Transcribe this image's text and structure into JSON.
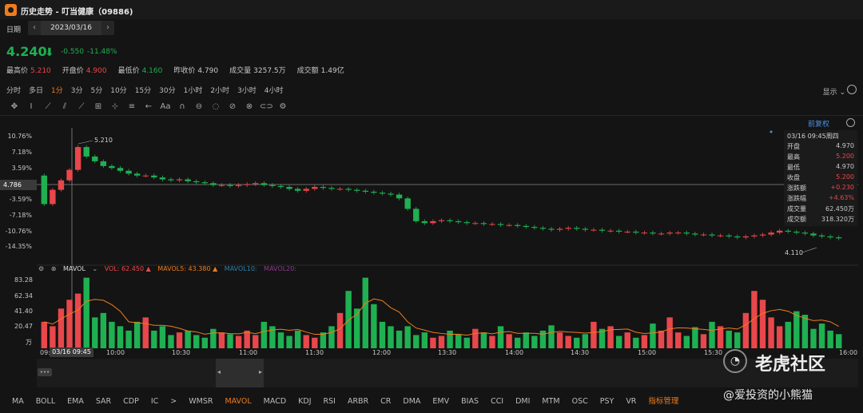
{
  "window": {
    "title": "历史走势 - 叮当健康（09886)"
  },
  "date_picker": {
    "label": "日期",
    "value": "2023/03/16",
    "prev_icon": "chevron-left-icon",
    "next_icon": "chevron-right-icon"
  },
  "quote": {
    "price": "4.240",
    "change": "-0.550",
    "change_pct": "-11.48%",
    "stats": [
      {
        "label": "最高价",
        "value": "5.210",
        "color": "red"
      },
      {
        "label": "开盘价",
        "value": "4.900",
        "color": "red"
      },
      {
        "label": "最低价",
        "value": "4.160",
        "color": "green"
      },
      {
        "label": "昨收价",
        "value": "4.790",
        "color": "grey"
      },
      {
        "label": "成交量",
        "value": "3257.5万",
        "color": "grey"
      },
      {
        "label": "成交额",
        "value": "1.49亿",
        "color": "grey"
      }
    ]
  },
  "periods": [
    "分时",
    "多日",
    "1分",
    "3分",
    "5分",
    "10分",
    "15分",
    "30分",
    "1小时",
    "2小时",
    "3小时",
    "4小时"
  ],
  "active_period": "1分",
  "display_menu": "显示",
  "restore_label": "前复权",
  "toolbar_icons": [
    "move-icon",
    "pointer-icon",
    "trend-line-icon",
    "parallel-icon",
    "channel-icon",
    "measure-icon",
    "ruler-icon",
    "fib-icon",
    "arrow-icon",
    "text-icon",
    "magnet-icon",
    "lock-icon",
    "eraser-icon",
    "hide-icon",
    "delete-icon",
    "link-icon",
    "settings-icon"
  ],
  "price_axis": [
    "10.76%",
    "7.18%",
    "3.59%",
    "4.786",
    "-3.59%",
    "-7.18%",
    "-10.76%",
    "-14.35%"
  ],
  "price_markers": {
    "high": "5.210",
    "low": "4.110",
    "prev_close_tag": "4.786"
  },
  "info_panel": {
    "header": "03/16 09:45周四",
    "rows": [
      {
        "label": "开盘",
        "value": "4.970",
        "color": "grey"
      },
      {
        "label": "最高",
        "value": "5.200",
        "color": "red"
      },
      {
        "label": "最低",
        "value": "4.970",
        "color": "grey"
      },
      {
        "label": "收盘",
        "value": "5.200",
        "color": "red"
      },
      {
        "label": "涨跌额",
        "value": "+0.230",
        "color": "red"
      },
      {
        "label": "涨跌幅",
        "value": "+4.63%",
        "color": "red"
      },
      {
        "label": "成交量",
        "value": "62.450万",
        "color": "grey"
      },
      {
        "label": "成交额",
        "value": "318.320万",
        "color": "grey"
      }
    ]
  },
  "volume": {
    "indicator": "MAVOL",
    "vol": "VOL: 62.450 ▲",
    "mavol5": "MAVOL5: 43.380 ▲",
    "mavol10": "MAVOL10:",
    "mavol20": "MAVOL20:",
    "axis": [
      "83.28",
      "62.34",
      "41.40",
      "20.47",
      "万"
    ]
  },
  "time_axis": [
    "09:",
    "10:00",
    "10:30",
    "11:00",
    "11:30",
    "12:00",
    "13:30",
    "14:00",
    "14:30",
    "15:00",
    "15:30",
    "16:00"
  ],
  "time_cursor": "03/16 09:45",
  "indicators": [
    "MA",
    "BOLL",
    "EMA",
    "SAR",
    "CDP",
    "IC",
    ">",
    "WMSR",
    "MAVOL",
    "MACD",
    "KDJ",
    "RSI",
    "ARBR",
    "CR",
    "DMA",
    "EMV",
    "BIAS",
    "CCI",
    "DMI",
    "MTM",
    "OSC",
    "PSY",
    "VR",
    "指标管理"
  ],
  "active_indicator": "MAVOL",
  "watermark": {
    "brand": "老虎社区",
    "user": "@爱投资的小熊猫"
  },
  "colors": {
    "up": "#e8474b",
    "down": "#1fb052",
    "accent": "#f07c1c",
    "link": "#4a8fe0"
  },
  "chart_data": {
    "type": "candlestick",
    "prev_close": 4.786,
    "high": 5.21,
    "low": 4.11,
    "cursor_time": "09:45",
    "series": [
      {
        "name": "close",
        "values": [
          4.6,
          4.75,
          4.85,
          4.96,
          5.2,
          5.1,
          5.05,
          5.0,
          4.98,
          4.95,
          4.92,
          4.9,
          4.9,
          4.88,
          4.86,
          4.85,
          4.86,
          4.84,
          4.83,
          4.82,
          4.8,
          4.8,
          4.79,
          4.8,
          4.81,
          4.82,
          4.8,
          4.79,
          4.78,
          4.76,
          4.74,
          4.76,
          4.78,
          4.77,
          4.76,
          4.76,
          4.75,
          4.74,
          4.73,
          4.72,
          4.71,
          4.7,
          4.66,
          4.55,
          4.42,
          4.4,
          4.42,
          4.43,
          4.42,
          4.41,
          4.4,
          4.4,
          4.39,
          4.39,
          4.38,
          4.38,
          4.37,
          4.36,
          4.35,
          4.34,
          4.33,
          4.34,
          4.35,
          4.34,
          4.33,
          4.33,
          4.32,
          4.32,
          4.31,
          4.31,
          4.3,
          4.3,
          4.29,
          4.29,
          4.3,
          4.3,
          4.29,
          4.28,
          4.28,
          4.27,
          4.27,
          4.26,
          4.25,
          4.26,
          4.27,
          4.28,
          4.3,
          4.32,
          4.31,
          4.3,
          4.29,
          4.27,
          4.26,
          4.25,
          4.24
        ]
      }
    ],
    "volume_values": [
      30,
      25,
      45,
      55,
      62,
      80,
      35,
      40,
      30,
      25,
      20,
      30,
      35,
      20,
      25,
      15,
      18,
      20,
      15,
      12,
      22,
      18,
      16,
      14,
      20,
      15,
      30,
      25,
      18,
      14,
      20,
      15,
      12,
      18,
      25,
      40,
      65,
      45,
      80,
      50,
      30,
      25,
      20,
      25,
      15,
      18,
      12,
      14,
      20,
      16,
      12,
      22,
      18,
      14,
      25,
      16,
      12,
      18,
      14,
      20,
      26,
      18,
      14,
      12,
      16,
      30,
      22,
      25,
      14,
      18,
      12,
      15,
      28,
      20,
      35,
      18,
      14,
      24,
      16,
      30,
      25,
      20,
      18,
      40,
      65,
      55,
      35,
      25,
      30,
      42,
      38,
      22,
      28,
      20,
      16
    ]
  }
}
